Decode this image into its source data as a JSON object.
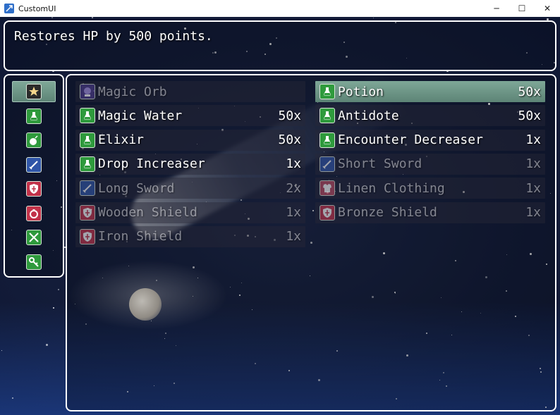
{
  "window": {
    "title": "CustomUI",
    "minimize": "─",
    "maximize": "☐",
    "close": "✕"
  },
  "help": {
    "text": "Restores HP by 500 points."
  },
  "categories": [
    {
      "icon": "star-icon",
      "color": "gold",
      "selected": true
    },
    {
      "icon": "potion-icon",
      "color": "green"
    },
    {
      "icon": "bomb-icon",
      "color": "green"
    },
    {
      "icon": "sword-icon",
      "color": "blue"
    },
    {
      "icon": "shield-icon",
      "color": "red"
    },
    {
      "icon": "ring-icon",
      "color": "red"
    },
    {
      "icon": "tools-icon",
      "color": "green"
    },
    {
      "icon": "key-icon",
      "color": "green"
    }
  ],
  "items": [
    {
      "name": "Magic Orb",
      "qty": "",
      "icon": "orb-icon",
      "enabled": false
    },
    {
      "name": "Potion",
      "qty": "50x",
      "icon": "potion-icon",
      "enabled": true,
      "selected": true
    },
    {
      "name": "Magic Water",
      "qty": "50x",
      "icon": "potion-icon",
      "enabled": true
    },
    {
      "name": "Antidote",
      "qty": "50x",
      "icon": "potion-icon",
      "enabled": true
    },
    {
      "name": "Elixir",
      "qty": "50x",
      "icon": "potion-icon",
      "enabled": true
    },
    {
      "name": "Encounter Decreaser",
      "qty": "1x",
      "icon": "potion-icon",
      "enabled": true
    },
    {
      "name": "Drop Increaser",
      "qty": "1x",
      "icon": "potion-icon",
      "enabled": true
    },
    {
      "name": "Short Sword",
      "qty": "1x",
      "icon": "sword-icon",
      "enabled": false
    },
    {
      "name": "Long Sword",
      "qty": "2x",
      "icon": "sword-icon",
      "enabled": false
    },
    {
      "name": "Linen Clothing",
      "qty": "1x",
      "icon": "armor-icon",
      "enabled": false
    },
    {
      "name": "Wooden Shield",
      "qty": "1x",
      "icon": "shield-icon",
      "enabled": false
    },
    {
      "name": "Bronze Shield",
      "qty": "1x",
      "icon": "shield-icon",
      "enabled": false
    },
    {
      "name": "Iron Shield",
      "qty": "1x",
      "icon": "shield-icon",
      "enabled": false
    }
  ]
}
